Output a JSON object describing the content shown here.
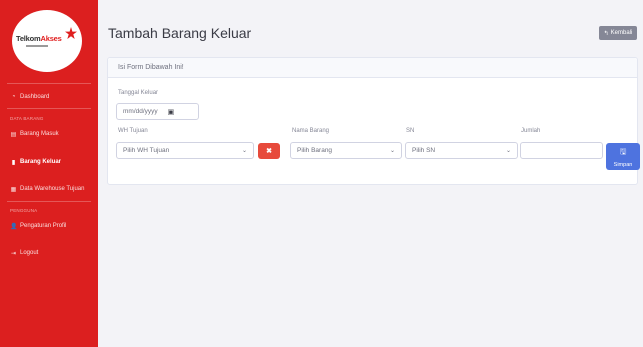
{
  "sidebar": {
    "logo": {
      "telkom": "Telkom",
      "akses": "Akses"
    },
    "items": [
      {
        "icon": "tachometer-icon",
        "glyph": "◔",
        "label": "Dashboard"
      },
      {
        "icon": "clipboard-icon",
        "glyph": "▤",
        "label": "Barang Masuk"
      },
      {
        "icon": "file-icon",
        "glyph": "▮",
        "label": "Barang Keluar"
      },
      {
        "icon": "table-icon",
        "glyph": "▦",
        "label": "Data Warehouse Tujuan"
      },
      {
        "icon": "user-icon",
        "glyph": "👤",
        "label": "Pengaturan Profil"
      },
      {
        "icon": "logout-icon",
        "glyph": "⇥",
        "label": "Logout"
      }
    ],
    "headings": {
      "data_barang": "DATA BARANG",
      "pengguna": "PENGGUNA"
    }
  },
  "header": {
    "title": "Tambah Barang Keluar",
    "back_icon": "reply-icon",
    "back_glyph": "↰",
    "back_label": "Kembali"
  },
  "form": {
    "card_title": "Isi Form Dibawah Ini!",
    "tanggal_label": "Tanggal Keluar",
    "tanggal_value": "mm/dd/yyyy",
    "wh_label": "WH Tujuan",
    "wh_value": "Pilih WH Tujuan",
    "barang_label": "Nama Barang",
    "barang_value": "Pilih Barang",
    "sn_label": "SN",
    "sn_value": "Pilih SN",
    "jumlah_label": "Jumlah",
    "jumlah_value": "",
    "clear_glyph": "✖",
    "save_icon": "save-icon",
    "save_glyph": "🖫",
    "save_label": "Simpan"
  },
  "colors": {
    "sidebar": "#dc1f1f",
    "primary": "#4e73df",
    "danger": "#e74a3b",
    "secondary": "#858796"
  }
}
